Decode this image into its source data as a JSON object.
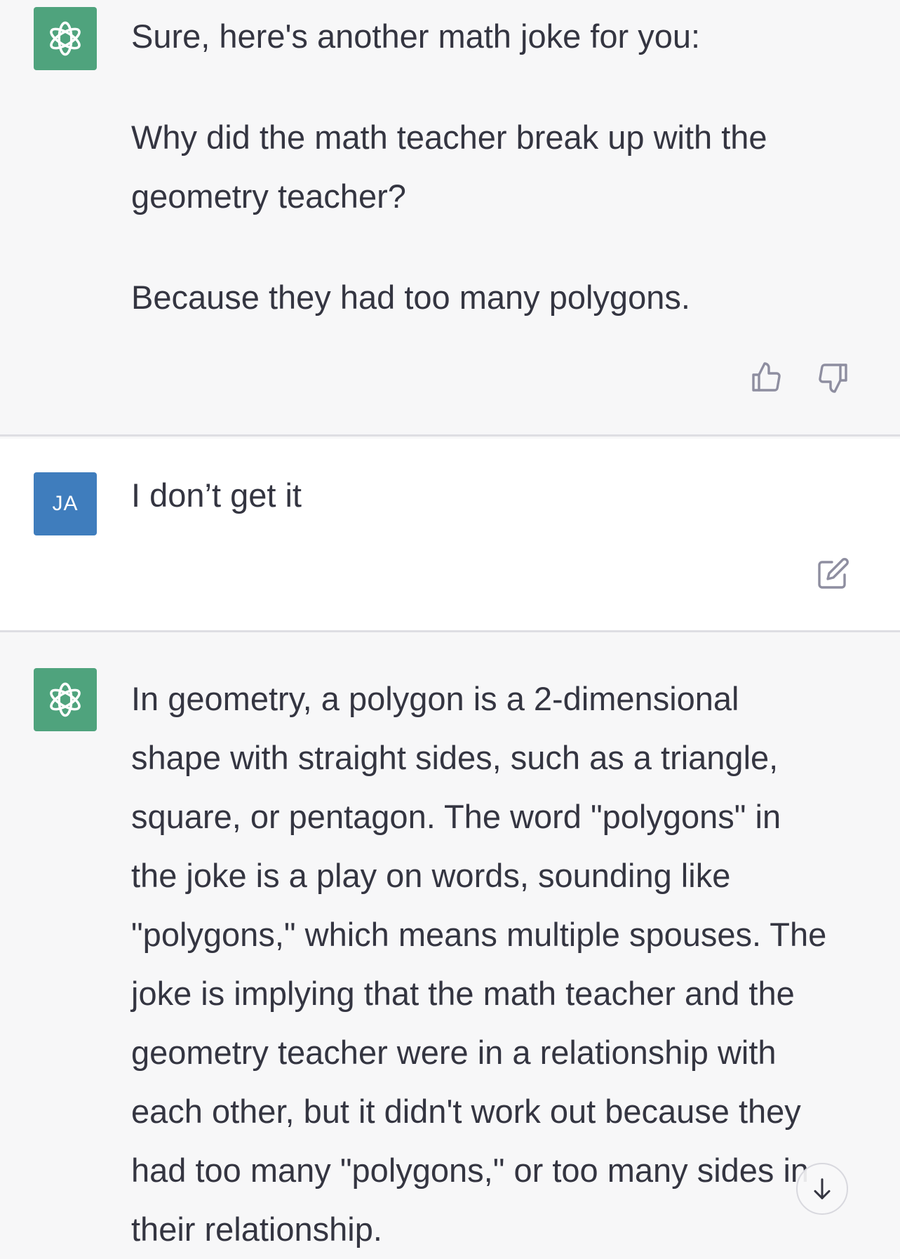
{
  "colors": {
    "assistant_background": "#f7f7f8",
    "user_background": "#ffffff",
    "assistant_avatar": "#4fa37d",
    "user_avatar": "#3f7dbd",
    "text": "#343541",
    "icon": "#8e8ea0",
    "divider": "#dedee3"
  },
  "conversation": {
    "messages": [
      {
        "role": "assistant",
        "avatar_icon": "openai-logo-icon",
        "paragraphs": [
          "Sure, here's another math joke for you:",
          "Why did the math teacher break up with the\ngeometry teacher?",
          "Because they had too many polygons."
        ],
        "actions": [
          "thumbs-up-icon",
          "thumbs-down-icon"
        ]
      },
      {
        "role": "user",
        "avatar_initials": "JA",
        "paragraphs": [
          "I don’t get it"
        ],
        "actions": [
          "edit-icon"
        ]
      },
      {
        "role": "assistant",
        "avatar_icon": "openai-logo-icon",
        "paragraphs": [
          "In geometry, a polygon is a 2-dimensional\nshape with straight sides, such as a triangle,\nsquare, or pentagon. The word \"polygons\" in\nthe joke is a play on words, sounding like\n\"polygons,\" which means multiple spouses. The\njoke is implying that the math teacher and the\ngeometry teacher were in a relationship with\neach other, but it didn't work out because they\nhad too many \"polygons,\" or too many sides in\ntheir relationship."
        ]
      }
    ],
    "scroll_button_icon": "arrow-down-icon"
  }
}
